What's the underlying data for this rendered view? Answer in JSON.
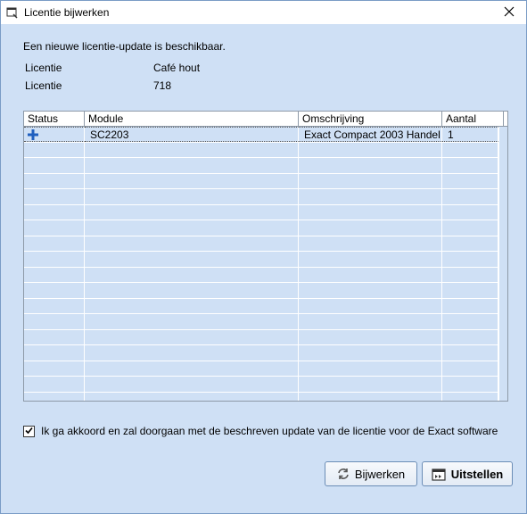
{
  "window": {
    "title": "Licentie bijwerken"
  },
  "message": "Een nieuwe licentie-update is beschikbaar.",
  "license_info": [
    {
      "label": "Licentie",
      "value": "Café hout"
    },
    {
      "label": "Licentie",
      "value": "718"
    }
  ],
  "grid": {
    "columns": [
      "Status",
      "Module",
      "Omschrijving",
      "Aantal"
    ],
    "rows": [
      {
        "status_icon": "plus-icon",
        "module": "SC2203",
        "omschrijving": "Exact Compact 2003 Handel ...",
        "aantal": "1"
      }
    ]
  },
  "agreement": {
    "checked": true,
    "text": "Ik ga akkoord en zal doorgaan met de beschreven update van de licentie voor de Exact software"
  },
  "buttons": {
    "update_label": "Bijwerken",
    "postpone_label": "Uitstellen"
  },
  "colors": {
    "accent": "#1f5fbf",
    "background": "#cfe0f5"
  }
}
